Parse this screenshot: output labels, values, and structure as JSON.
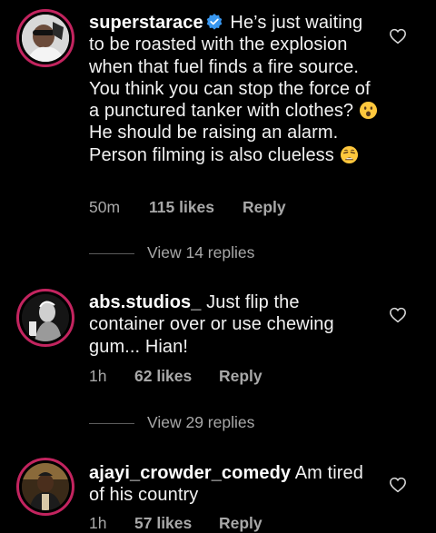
{
  "comments": [
    {
      "username": "superstarace",
      "verified": true,
      "text_part1": "He’s just waiting to be roasted with the explosion when that fuel finds a fire source. You think you can stop the force of a punctured tanker with clothes?",
      "emoji1": "hushed-face-emoji",
      "text_part2": "He should be raising an alarm. Person filming is also clueless",
      "emoji2": "weary-face-emoji",
      "time": "50m",
      "likes": "115 likes",
      "reply": "Reply",
      "view_replies": "View 14 replies"
    },
    {
      "username": "abs.studios_",
      "verified": false,
      "text": "Just flip the container over or use chewing gum... Hian!",
      "time": "1h",
      "likes": "62 likes",
      "reply": "Reply",
      "view_replies": "View 29 replies"
    },
    {
      "username": "ajayi_crowder_comedy",
      "verified": false,
      "text": "Am tired of his country",
      "time": "1h",
      "likes": "57 likes",
      "reply": "Reply"
    }
  ],
  "colors": {
    "background": "#000000",
    "text": "#f2f2f2",
    "meta": "#a8a8a8",
    "avatar_ring": "#c3245f",
    "verified": "#3897f0"
  }
}
